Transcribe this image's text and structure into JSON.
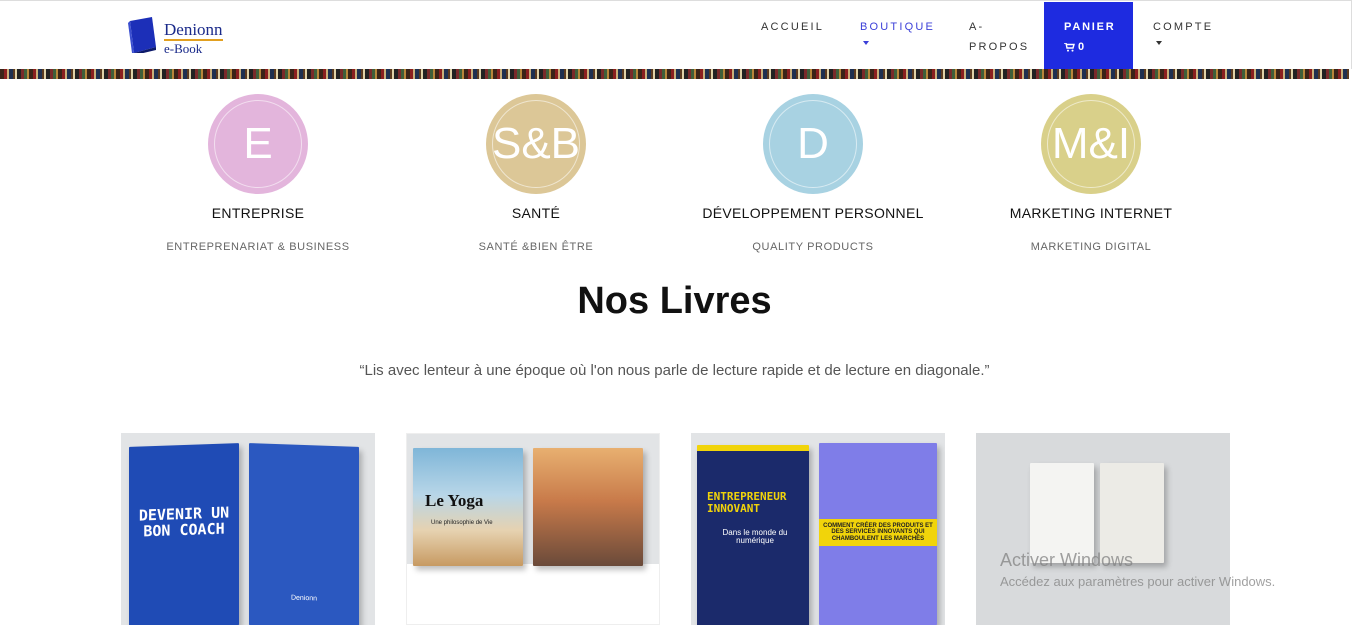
{
  "header": {
    "logo": {
      "name": "Denionn",
      "sub": "e-Book"
    },
    "nav": {
      "accueil": "ACCUEIL",
      "boutique": "BOUTIQUE",
      "apropos_1": "A-",
      "apropos_2": "PROPOS",
      "panier": "PANIER",
      "panier_count": "0",
      "compte": "COMPTE"
    },
    "colors": {
      "accent": "#1e2be0",
      "active_link": "#3b3fd8"
    }
  },
  "categories": [
    {
      "letter": "E",
      "title": "ENTREPRISE",
      "subtitle": "ENTREPRENARIAT & BUSINESS",
      "color": "#e3b5dc"
    },
    {
      "letter": "S&B",
      "title": "SANTÉ",
      "subtitle": "SANTÉ &BIEN ÊTRE",
      "color": "#dcc797"
    },
    {
      "letter": "D",
      "title": "DÉVELOPPEMENT PERSONNEL",
      "subtitle": "QUALITY PRODUCTS",
      "color": "#a8d2e2"
    },
    {
      "letter": "M&I",
      "title": "MARKETING INTERNET",
      "subtitle": "MARKETING DIGITAL",
      "color": "#d9d08a"
    }
  ],
  "books_section": {
    "title": "Nos Livres",
    "quote": "“Lis avec lenteur à une époque où l'on nous parle de lecture rapide et de lecture en diagonale.”"
  },
  "products": [
    {
      "cover_text": "DEVENIR UN BON COACH",
      "back_text": "Denionn"
    },
    {
      "cover_text": "Le Yoga",
      "cover_sub": "Une philosophie de Vie"
    },
    {
      "cover_text": "ENTREPRENEUR INNOVANT",
      "cover_sub": "Dans le monde du numérique",
      "back_text": "COMMENT CRÉER DES PRODUITS ET DES SERVICES INNOVANTS QUI CHAMBOULENT LES MARCHÉS"
    },
    {
      "cover_text": ""
    }
  ],
  "windows_watermark": {
    "title": "Activer Windows",
    "subtitle": "Accédez aux paramètres pour activer Windows."
  }
}
